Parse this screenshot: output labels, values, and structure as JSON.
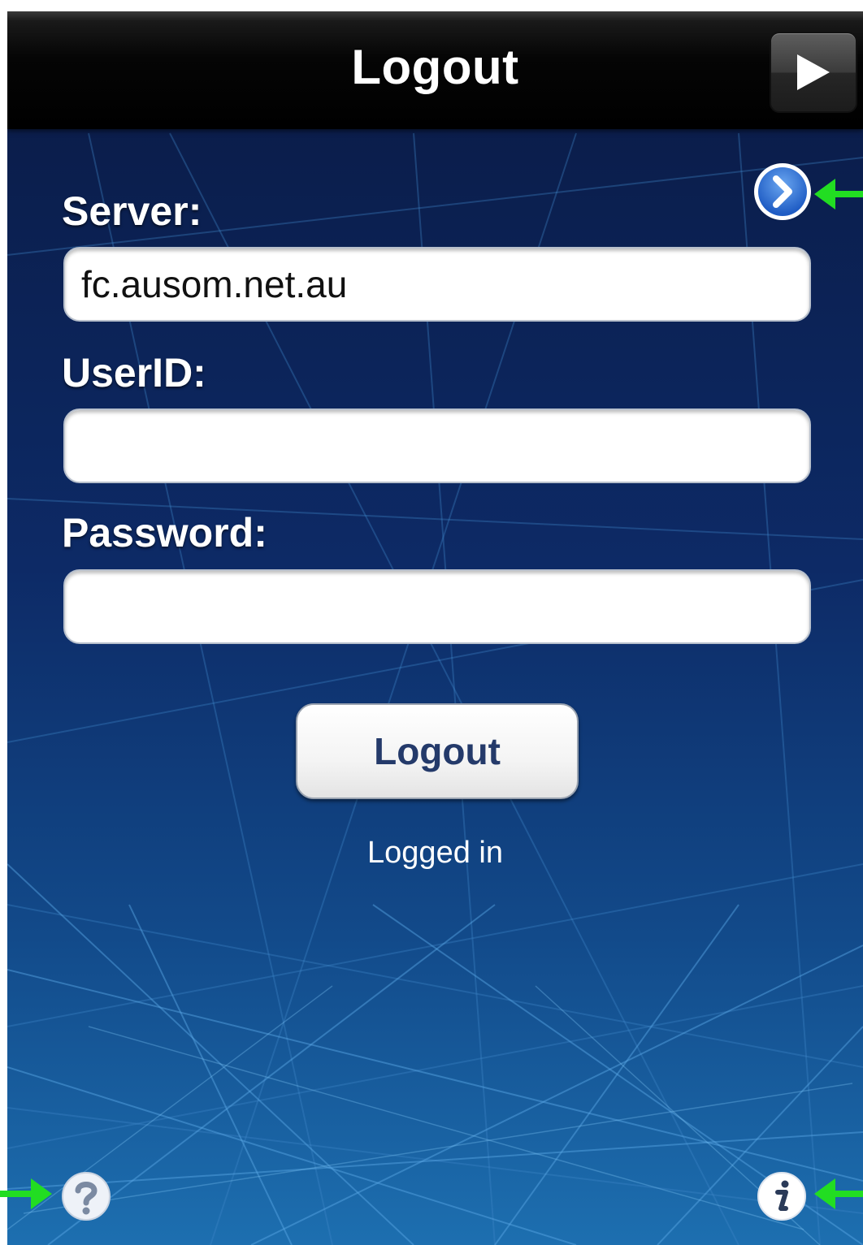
{
  "navbar": {
    "title": "Logout",
    "play_button_icon": "play-icon"
  },
  "server": {
    "label": "Server:",
    "value": "fc.ausom.net.au",
    "disclosure_icon": "chevron-right-circle-icon"
  },
  "userid": {
    "label": "UserID:",
    "value": ""
  },
  "password": {
    "label": "Password:",
    "value": ""
  },
  "logout_button": {
    "label": "Logout"
  },
  "status": {
    "text": "Logged in"
  },
  "footer": {
    "help_icon": "question-mark-icon",
    "info_icon": "info-icon"
  },
  "colors": {
    "background": "#0a1f4a",
    "navbar": "#000000",
    "button_text": "#243a6a",
    "disclosure": "#2f6fd6",
    "annotation_arrow": "#22dd22"
  }
}
